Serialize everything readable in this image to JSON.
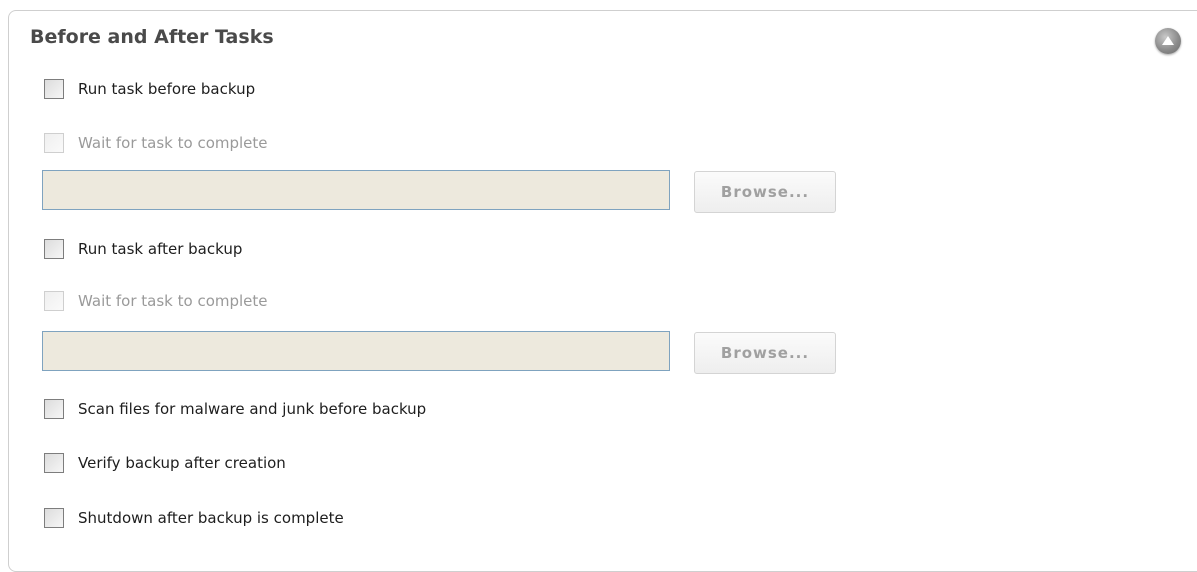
{
  "section": {
    "title": "Before and After Tasks",
    "collapse_icon": "chevron-up-icon"
  },
  "options": {
    "run_before": {
      "label": "Run task before backup",
      "checked": false,
      "enabled": true
    },
    "wait_before": {
      "label": "Wait for task to complete",
      "checked": false,
      "enabled": false
    },
    "before_path": {
      "value": "",
      "placeholder": ""
    },
    "before_browse": {
      "label": "Browse..."
    },
    "run_after": {
      "label": "Run task after backup",
      "checked": false,
      "enabled": true
    },
    "wait_after": {
      "label": "Wait for task to complete",
      "checked": false,
      "enabled": false
    },
    "after_path": {
      "value": "",
      "placeholder": ""
    },
    "after_browse": {
      "label": "Browse..."
    },
    "scan_files": {
      "label": "Scan files for malware and junk before backup",
      "checked": false,
      "enabled": true
    },
    "verify_backup": {
      "label": "Verify backup after creation",
      "checked": false,
      "enabled": true
    },
    "shutdown": {
      "label": "Shutdown after backup is complete",
      "checked": false,
      "enabled": true
    }
  },
  "colors": {
    "input_background": "#ede9dd",
    "input_border": "#7fa3bf",
    "title_text": "#4a4a4a",
    "disabled_text": "#9a9a9a"
  }
}
